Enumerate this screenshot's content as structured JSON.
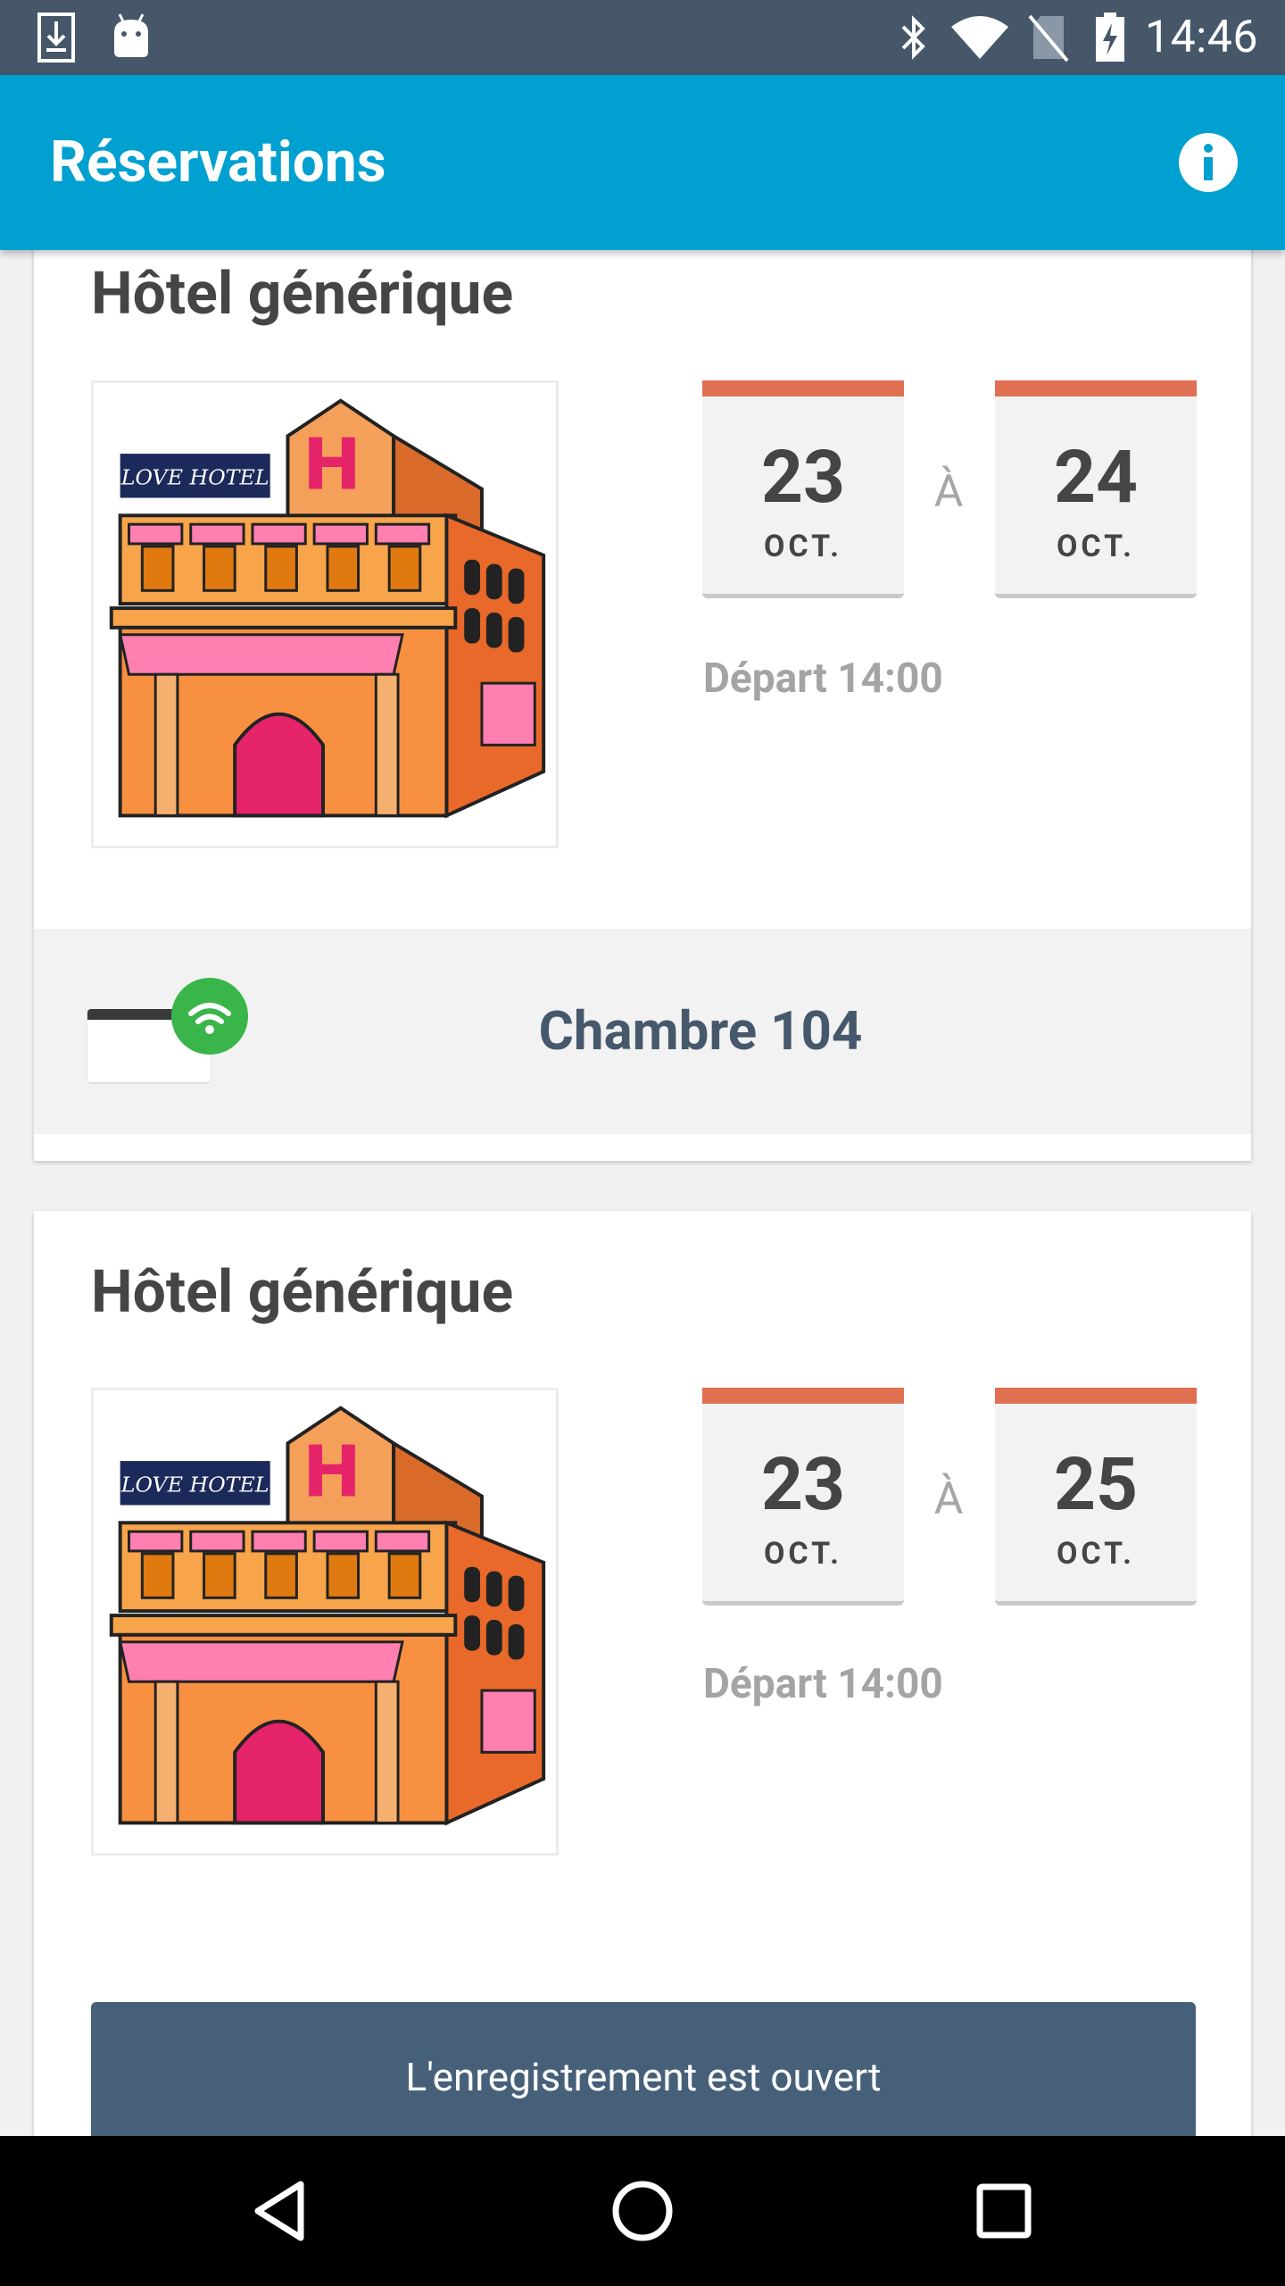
{
  "status_bar": {
    "time": "14:46",
    "icons": [
      "download-icon",
      "android-icon",
      "bluetooth-icon",
      "wifi-icon",
      "no-sim-icon",
      "battery-charging-icon"
    ]
  },
  "app_bar": {
    "title": "Réservations",
    "info_icon": "info-icon"
  },
  "reservations": [
    {
      "hotel_name": "Hôtel générique",
      "image_label": "LOVE HOTEL",
      "from": {
        "day": "23",
        "month": "OCT."
      },
      "separator": "À",
      "to": {
        "day": "24",
        "month": "OCT."
      },
      "departure": "Départ 14:00",
      "room_label": "Chambre 104"
    },
    {
      "hotel_name": "Hôtel générique",
      "image_label": "LOVE HOTEL",
      "from": {
        "day": "23",
        "month": "OCT."
      },
      "separator": "À",
      "to": {
        "day": "25",
        "month": "OCT."
      },
      "departure": "Départ 14:00",
      "checkin_label": "L'enregistrement est ouvert"
    }
  ],
  "nav_bar": {
    "icons": [
      "back-icon",
      "home-icon",
      "recents-icon"
    ]
  },
  "colors": {
    "status_bar": "#46576a",
    "app_bar": "#00a0d1",
    "date_accent": "#e07052",
    "room_text": "#46586b",
    "checkin_button": "#46607a",
    "wifi_badge": "#39b54a"
  }
}
